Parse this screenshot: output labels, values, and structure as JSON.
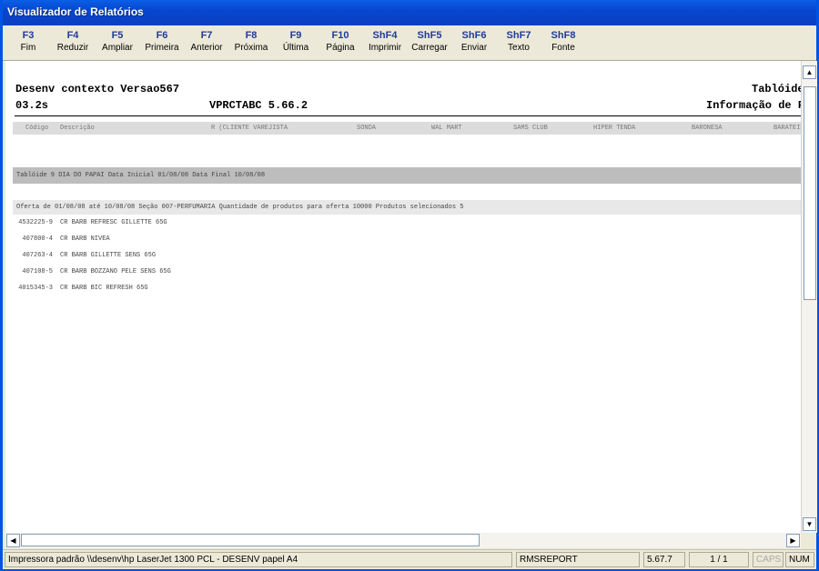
{
  "window": {
    "title": "Visualizador de Relatórios"
  },
  "toolbar": [
    {
      "key": "F3",
      "label": "Fim"
    },
    {
      "key": "F4",
      "label": "Reduzir"
    },
    {
      "key": "F5",
      "label": "Ampliar"
    },
    {
      "key": "F6",
      "label": "Primeira"
    },
    {
      "key": "F7",
      "label": "Anterior"
    },
    {
      "key": "F8",
      "label": "Próxima"
    },
    {
      "key": "F9",
      "label": "Última"
    },
    {
      "key": "F10",
      "label": "Página"
    },
    {
      "key": "ShF4",
      "label": "Imprimir"
    },
    {
      "key": "ShF5",
      "label": "Carregar"
    },
    {
      "key": "ShF6",
      "label": "Enviar"
    },
    {
      "key": "ShF7",
      "label": "Texto"
    },
    {
      "key": "ShF8",
      "label": "Fonte"
    }
  ],
  "report": {
    "header_left_1": "Desenv contexto Versao567",
    "header_right_1": "Tablóide",
    "header_left_2": "03.2s",
    "header_center_2": "VPRCTABC 5.66.2",
    "header_right_2": "Informação de P",
    "columns": [
      "Código",
      "Descrição",
      "R (CLIENTE VAREJISTA",
      "SONDA",
      "WAL MART",
      "SAMS CLUB",
      "HIPER TENDA",
      "BARONESA",
      "BARATEIR"
    ],
    "tabloide_line": "Tablóide 9 DIA DO PAPAI  Data Inicial 01/08/08  Data Final 10/08/08",
    "offer_line": "Oferta de 01/08/08 até 10/08/08  Seção 007-PERFUMARIA  Quantidade de produtos para oferta 10000  Produtos selecionados      5",
    "products": [
      {
        "code": "4532225-9",
        "desc": "CR BARB REFRESC GILLETTE 65G"
      },
      {
        "code": "407800-4",
        "desc": "CR BARB NIVEA"
      },
      {
        "code": "407263-4",
        "desc": "CR BARB GILLETTE SENS 65G"
      },
      {
        "code": "407108-5",
        "desc": "CR BARB BOZZANO PELE SENS 65G"
      },
      {
        "code": "4015345-3",
        "desc": "CR BARB BIC REFRESH 65G"
      }
    ]
  },
  "statusbar": {
    "printer": "Impressora padrão \\\\desenv\\hp LaserJet 1300 PCL - DESENV papel A4",
    "module": "RMSREPORT",
    "version": "5.67.7",
    "page": "1 / 1",
    "caps": "CAPS",
    "num": "NUM"
  }
}
